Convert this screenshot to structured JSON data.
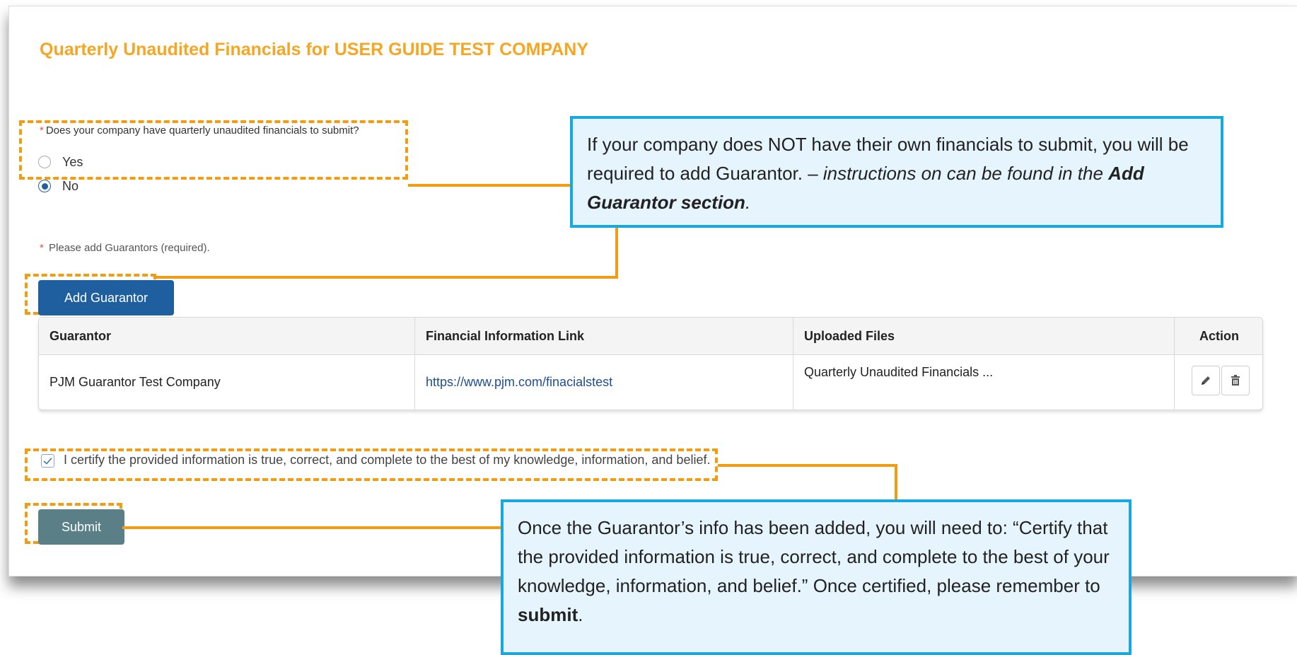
{
  "page": {
    "title": "Quarterly Unaudited Financials for USER GUIDE TEST COMPANY",
    "question": {
      "required_mark": "*",
      "label": "Does your company have quarterly unaudited financials to submit?",
      "options": [
        {
          "label": "Yes",
          "selected": false
        },
        {
          "label": "No",
          "selected": true
        }
      ]
    },
    "guarantor_note": {
      "required_mark": "*",
      "text": "Please add Guarantors (required)."
    },
    "add_guarantor_label": "Add Guarantor",
    "table": {
      "columns": [
        "Guarantor",
        "Financial Information Link",
        "Uploaded Files",
        "Action"
      ],
      "rows": [
        {
          "guarantor": "PJM Guarantor Test Company",
          "link": "https://www.pjm.com/finacialstest",
          "files": "Quarterly Unaudited Financials ...",
          "actions": [
            "pencil-icon",
            "trash-icon"
          ]
        }
      ]
    },
    "certify": {
      "checked": true,
      "label": "I certify the provided information is true, correct, and complete to the best of my knowledge, information, and belief."
    },
    "submit_label": "Submit"
  },
  "callouts": {
    "top": {
      "text1": "If your company does NOT have their own financials to submit, you will be required to add Guarantor. – ",
      "italic1": "instructions on can be found in the ",
      "bold_italic": "Add Guarantor section",
      "end": "."
    },
    "bottom": {
      "text1": "Once the Guarantor’s info has been added, you will need to: “Certify that the provided information is true, correct, and complete to the best of your knowledge, information, and belief.” Once certified, please remember to ",
      "bold": "submit",
      "end": "."
    }
  },
  "colors": {
    "title": "#f5a623",
    "highlight": "#f39c12",
    "callout_border": "#17a8e0",
    "callout_bg": "#e6f4fd",
    "primary_button": "#1f5fa0",
    "submit_button": "#5a7f86"
  }
}
